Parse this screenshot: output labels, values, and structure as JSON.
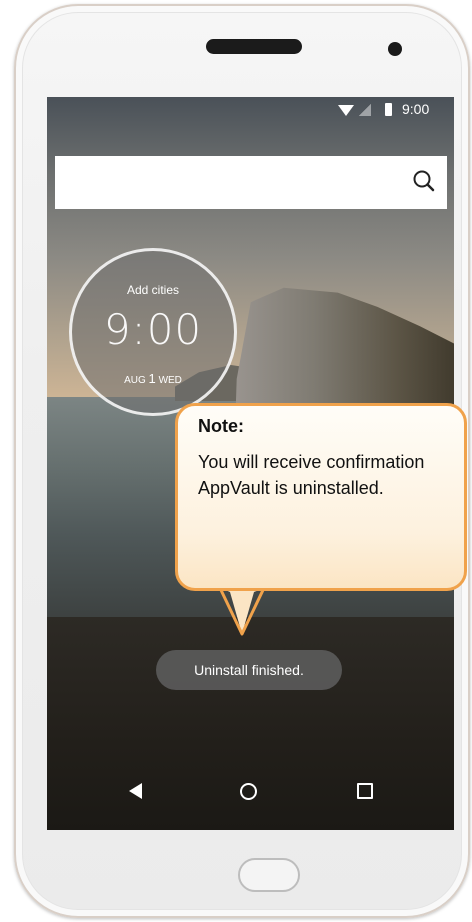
{
  "status_bar": {
    "time": "9:00"
  },
  "search": {
    "placeholder": ""
  },
  "clock_widget": {
    "add_cities": "Add cities",
    "time": "9:00",
    "month": "AUG",
    "day": "1",
    "weekday": "WED"
  },
  "toast": {
    "message": "Uninstall finished."
  },
  "callout": {
    "title": "Note:",
    "body": "You will receive confirmation AppVault is uninstalled."
  },
  "nav_bar": {
    "icons": [
      "back-icon",
      "home-icon",
      "recents-icon"
    ]
  },
  "colors": {
    "callout_border": "#f0a24b",
    "toast_bg": "#5a5a5a"
  }
}
